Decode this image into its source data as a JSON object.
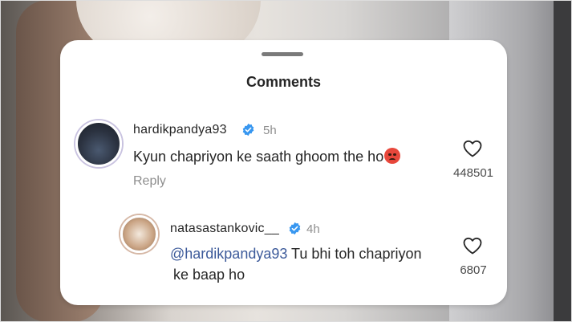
{
  "sheet": {
    "title": "Comments"
  },
  "comments": [
    {
      "username": "hardikpandya93",
      "time": "5h",
      "text": "Kyun chapriyon ke saath ghoom the ho",
      "reply_label": "Reply",
      "likes": "448501",
      "icons": {
        "verified": "verified-badge-icon",
        "like": "heart-icon",
        "emoji": "angry-face-emoji"
      }
    },
    {
      "username": "natasastankovic__",
      "time": "4h",
      "mention": "@hardikpandya93",
      "text_line1": " Tu bhi toh chapriyon",
      "text_line2": "ke baap ho",
      "likes": "6807",
      "icons": {
        "verified": "verified-badge-icon",
        "like": "heart-icon"
      }
    }
  ],
  "colors": {
    "verified_blue": "#3897f0",
    "mention": "#3c5a9a",
    "muted": "#8e8e8e"
  }
}
